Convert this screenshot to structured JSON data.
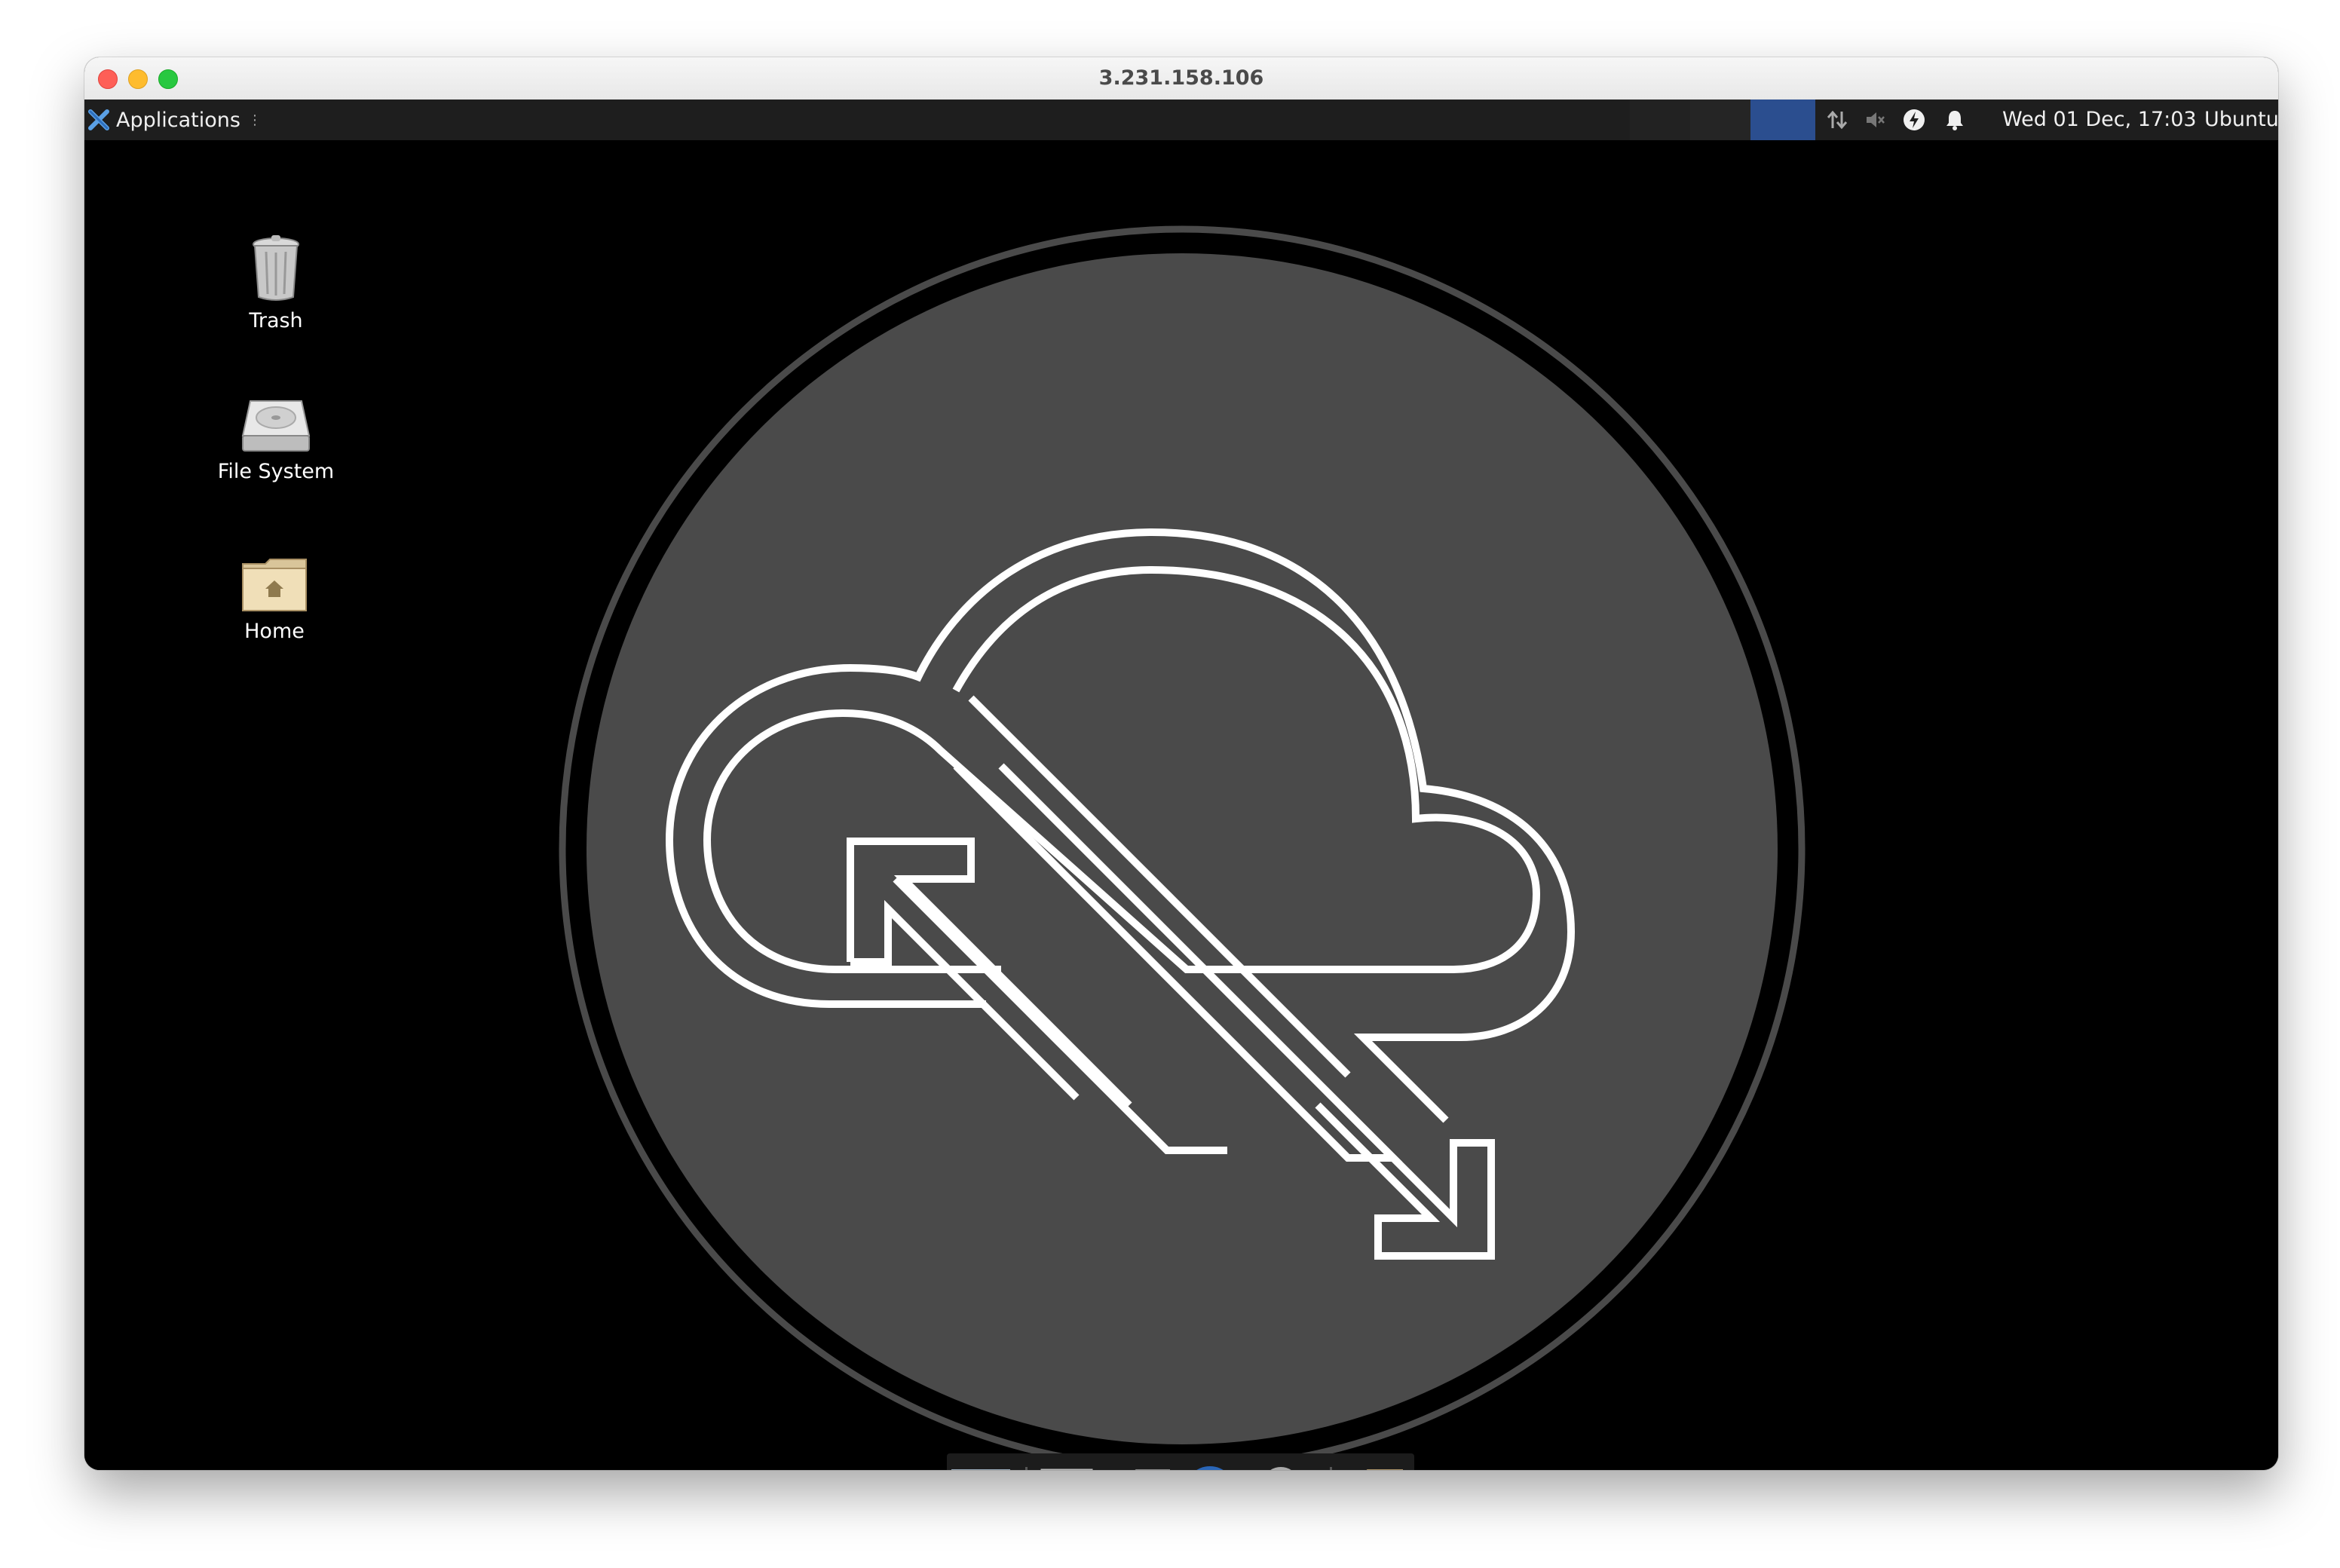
{
  "window": {
    "title": "3.231.158.106"
  },
  "panel": {
    "applications_label": "Applications",
    "clock": "Wed 01 Dec, 17:03",
    "user": "Ubuntu",
    "tray_icons": [
      "network-arrows-icon",
      "volume-muted-icon",
      "power-icon",
      "notification-bell-icon"
    ]
  },
  "desktop": {
    "icons": [
      {
        "label": "Trash",
        "icon": "trash-icon"
      },
      {
        "label": "File System",
        "icon": "hard-drive-icon"
      },
      {
        "label": "Home",
        "icon": "home-folder-icon"
      }
    ],
    "wallpaper_icon": "cloud-sync-logo"
  },
  "dock": {
    "items": [
      {
        "name": "show-desktop",
        "icon": "desktop-icon"
      },
      {
        "name": "terminal",
        "icon": "terminal-icon"
      },
      {
        "name": "file-manager",
        "icon": "home-folder-icon"
      },
      {
        "name": "web-browser",
        "icon": "globe-icon"
      },
      {
        "name": "app-finder",
        "icon": "magnifier-icon"
      },
      {
        "name": "folder",
        "icon": "folder-icon"
      }
    ]
  },
  "colors": {
    "panel_bg": "#1e1e1e",
    "workspace_active": "#2b4e8f",
    "wallpaper_disc": "#4a4a4a"
  }
}
